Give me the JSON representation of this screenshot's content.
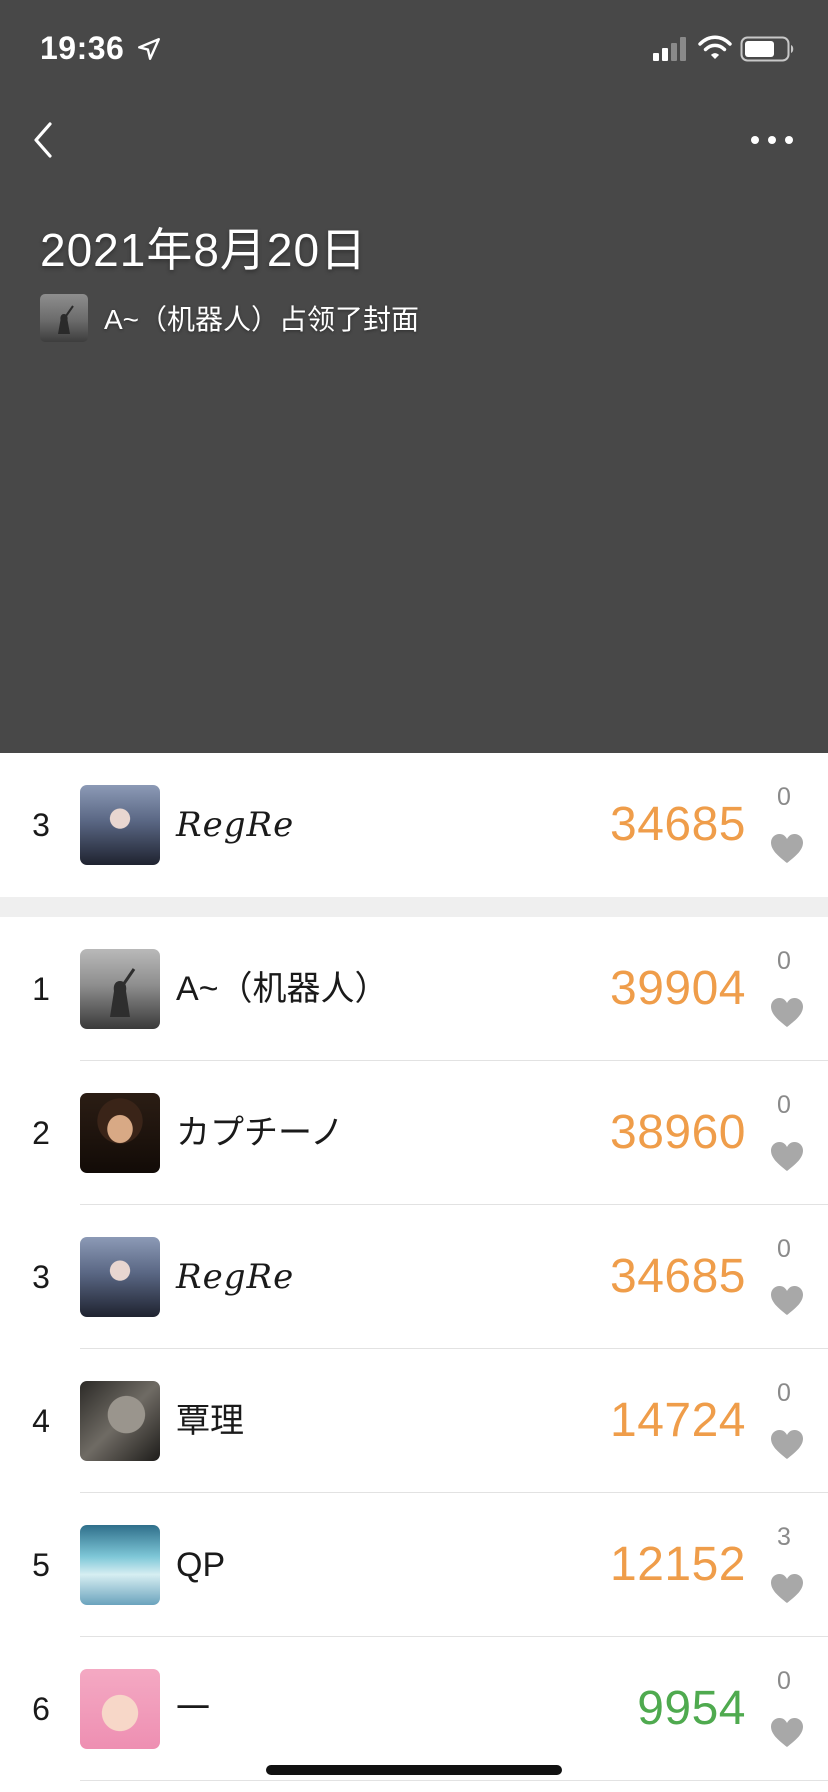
{
  "status_bar": {
    "time": "19:36",
    "icons": [
      "location-arrow-icon",
      "cellular-signal-icon",
      "wifi-icon",
      "battery-icon"
    ]
  },
  "nav": {
    "back_icon": "chevron-left-icon",
    "more_icon": "more-dots-icon"
  },
  "cover": {
    "date_title": "2021年8月20日",
    "cover_owner_text": "A~（机器人）占领了封面"
  },
  "my_rank": {
    "rank": "3",
    "name": "RegRe",
    "steps": "34685",
    "likes": "0"
  },
  "leaderboard": [
    {
      "rank": "1",
      "name": "A~（机器人）",
      "steps": "39904",
      "likes": "0"
    },
    {
      "rank": "2",
      "name": "カプチーノ",
      "steps": "38960",
      "likes": "0"
    },
    {
      "rank": "3",
      "name": "RegRe",
      "steps": "34685",
      "likes": "0"
    },
    {
      "rank": "4",
      "name": "覃理",
      "steps": "14724",
      "likes": "0"
    },
    {
      "rank": "5",
      "name": "QP",
      "steps": "12152",
      "likes": "3"
    },
    {
      "rank": "6",
      "name": "一",
      "steps": "9954",
      "likes": "0"
    }
  ],
  "colors": {
    "cover_bg": "#484848",
    "steps_orange": "#ef9d4a",
    "steps_green": "#4faa4f",
    "like_gray": "#a8a8a8"
  }
}
